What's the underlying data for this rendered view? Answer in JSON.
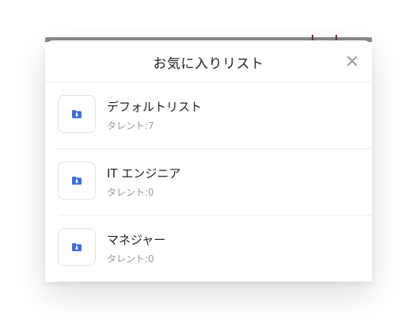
{
  "modal": {
    "title": "お気に入りリスト",
    "close_icon": "close-icon"
  },
  "lists": [
    {
      "name": "デフォルトリスト",
      "count_label": "タレント:7",
      "icon": "folder-icon"
    },
    {
      "name": "IT エンジニア",
      "count_label": "タレント:0",
      "icon": "folder-icon"
    },
    {
      "name": "マネジャー",
      "count_label": "タレント:0",
      "icon": "folder-icon"
    }
  ],
  "colors": {
    "accent": "#3f6fe0",
    "title_text": "#222222",
    "secondary_text": "#9a9a9a",
    "divider": "#ececec"
  }
}
